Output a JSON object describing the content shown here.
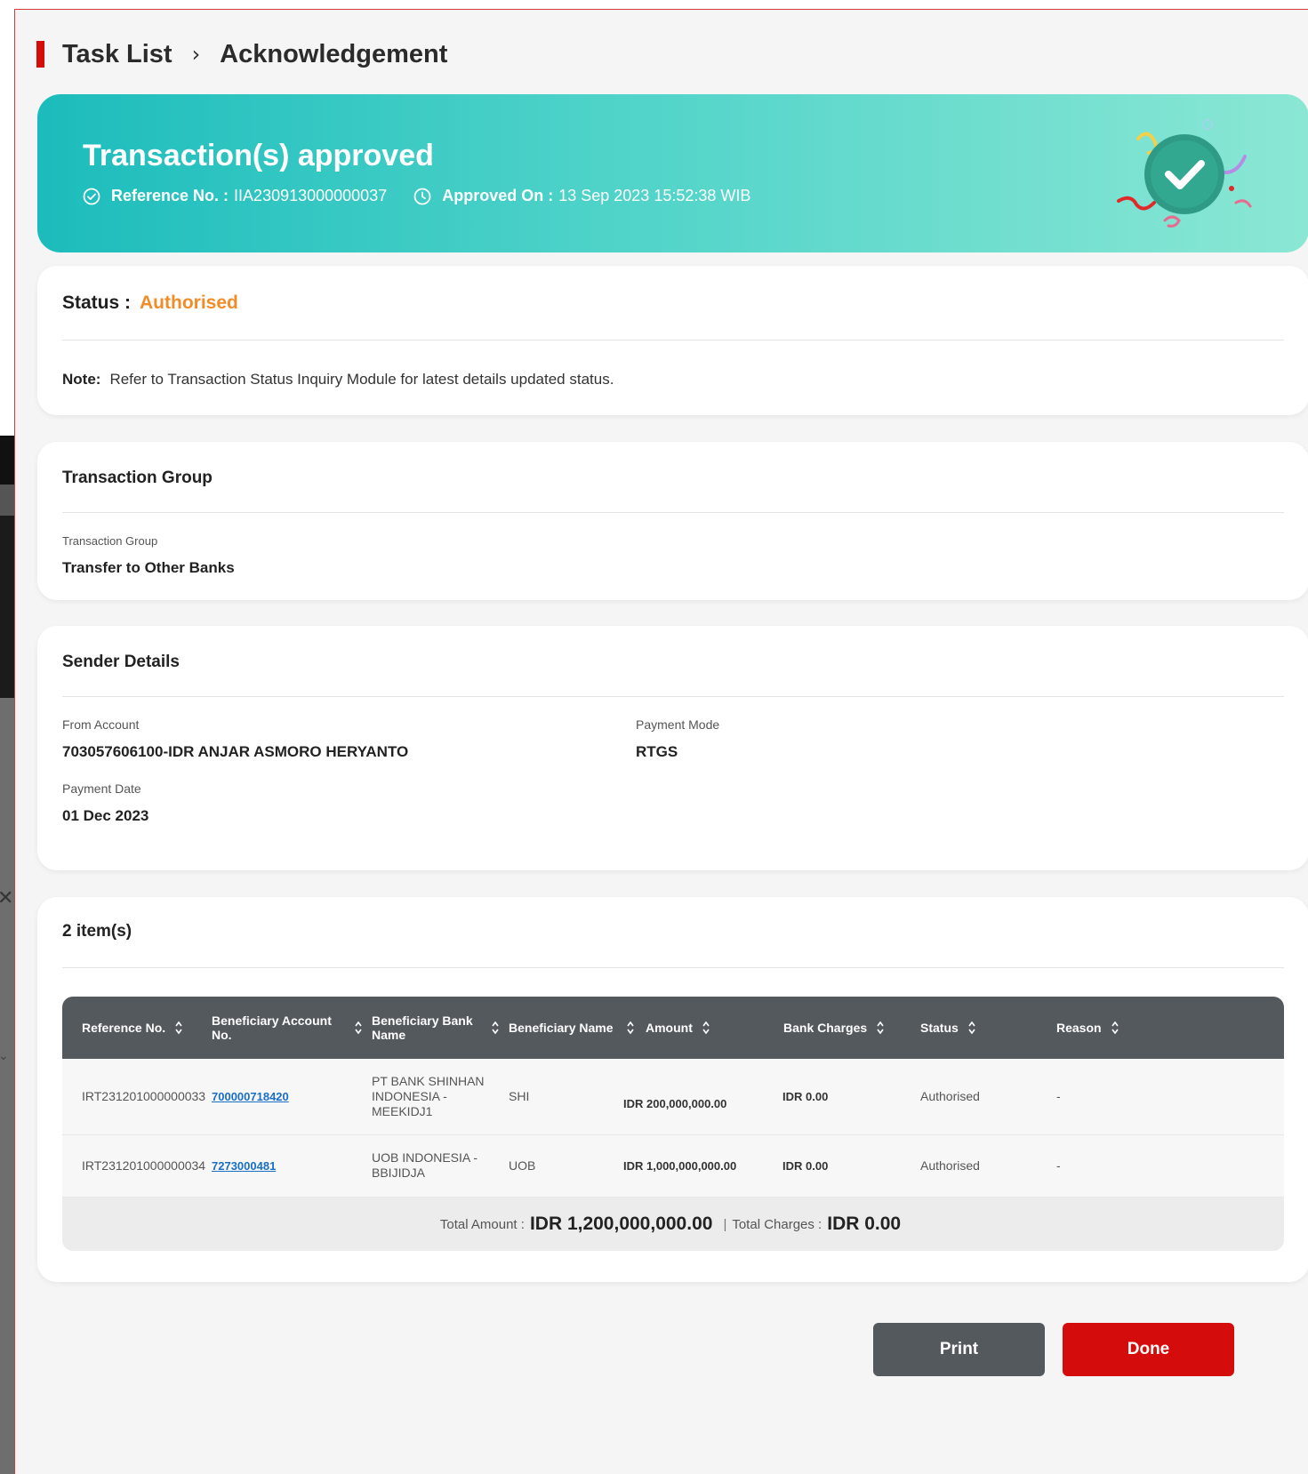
{
  "breadcrumb": {
    "items": [
      "Task List",
      "Acknowledgement"
    ],
    "separator": "›"
  },
  "banner": {
    "title": "Transaction(s) approved",
    "reference_label": "Reference No. :",
    "reference_value": "IIA230913000000037",
    "approved_label": "Approved On :",
    "approved_value": "13 Sep 2023 15:52:38 WIB",
    "icons": [
      "check-circle-icon",
      "clock-icon",
      "success-check-illustration"
    ]
  },
  "status_card": {
    "status_label": "Status :",
    "status_value": "Authorised",
    "note_label": "Note:",
    "note_text": "Refer to Transaction Status Inquiry Module for latest details updated status."
  },
  "transaction_group": {
    "heading": "Transaction Group",
    "field_label": "Transaction Group",
    "field_value": "Transfer to Other Banks"
  },
  "sender_details": {
    "heading": "Sender Details",
    "from_account_label": "From Account",
    "from_account_value": "703057606100-IDR ANJAR ASMORO HERYANTO",
    "payment_mode_label": "Payment Mode",
    "payment_mode_value": "RTGS",
    "payment_date_label": "Payment Date",
    "payment_date_value": "01 Dec 2023"
  },
  "items": {
    "count_label": "2 item(s)",
    "columns": [
      "Reference No.",
      "Beneficiary Account No.",
      "Beneficiary Bank Name",
      "Beneficiary Name",
      "Amount",
      "Bank Charges",
      "Status",
      "Reason"
    ],
    "rows": [
      {
        "reference": "IRT231201000000033",
        "account": "700000718420",
        "bank": "PT BANK SHINHAN INDONESIA - MEEKIDJ1",
        "name": "SHI",
        "amount": "IDR 200,000,000.00",
        "charges": "IDR 0.00",
        "status": "Authorised",
        "reason": "-"
      },
      {
        "reference": "IRT231201000000034",
        "account": "7273000481",
        "bank": "UOB INDONESIA - BBIJIDJA",
        "name": "UOB",
        "amount": "IDR 1,000,000,000.00",
        "charges": "IDR 0.00",
        "status": "Authorised",
        "reason": "-"
      }
    ],
    "total_amount_label": "Total Amount :",
    "total_amount_value": "IDR 1,200,000,000.00",
    "total_charges_label": "Total Charges :",
    "total_charges_value": "IDR 0.00"
  },
  "buttons": {
    "print": "Print",
    "done": "Done"
  },
  "colors": {
    "brand_red": "#d50c0c",
    "status_orange": "#f28c28",
    "banner_start": "#1cbcbc",
    "banner_end": "#8be7d4",
    "table_header": "#54595e",
    "link_blue": "#1a6fc4"
  }
}
